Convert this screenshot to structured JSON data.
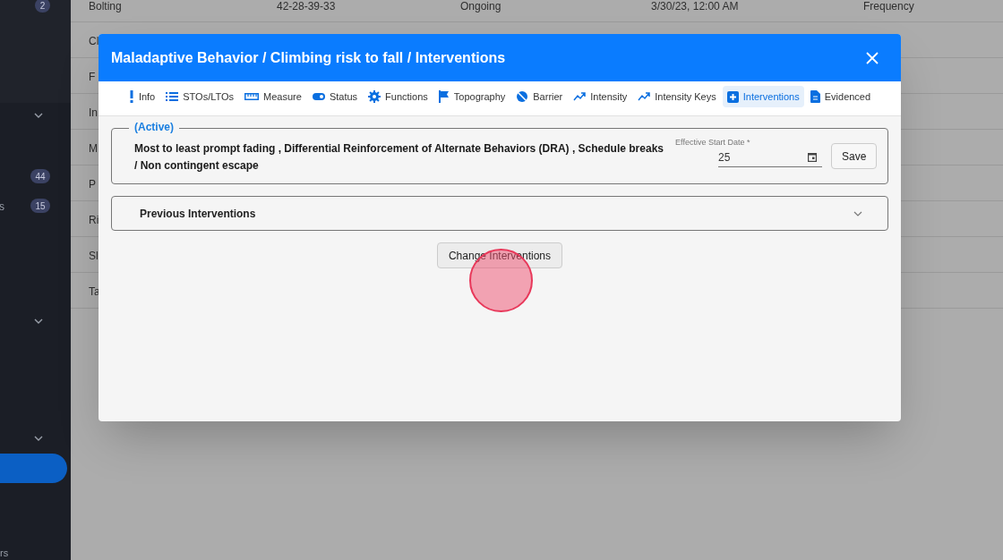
{
  "sidebar": {
    "badges": [
      {
        "text": "2"
      },
      {
        "text": "44"
      },
      {
        "text": "15",
        "label": "s"
      }
    ],
    "footer_text": "rs",
    "active_item": true
  },
  "background_table": {
    "header_row": [
      "Bolting",
      "42-28-39-33",
      "Ongoing",
      "3/30/23, 12:00 AM",
      "Frequency"
    ],
    "rows": [
      "Cl",
      "F",
      "In",
      "M",
      "P",
      "Ri",
      "Sl",
      "Ta"
    ]
  },
  "dialog": {
    "title": "Maladaptive Behavior / Climbing risk to fall / Interventions",
    "tabs": [
      {
        "label": "Info",
        "selected": false
      },
      {
        "label": "STOs/LTOs",
        "selected": false
      },
      {
        "label": "Measure",
        "selected": false
      },
      {
        "label": "Status",
        "selected": false
      },
      {
        "label": "Functions",
        "selected": false
      },
      {
        "label": "Topography",
        "selected": false
      },
      {
        "label": "Barrier",
        "selected": false
      },
      {
        "label": "Intensity",
        "selected": false
      },
      {
        "label": "Intensity Keys",
        "selected": false
      },
      {
        "label": "Interventions",
        "selected": true
      },
      {
        "label": "Evidenced",
        "selected": false
      }
    ],
    "active": {
      "legend": "(Active)",
      "text": "Most to least prompt fading , Differential Reinforcement of Alternate Behaviors (DRA) , Schedule breaks / Non contingent escape",
      "date_label": "Effective Start Date *",
      "date_value": "25",
      "save": "Save"
    },
    "previous": {
      "label": "Previous Interventions",
      "expanded": false
    },
    "change_button": "Change Interventions"
  }
}
